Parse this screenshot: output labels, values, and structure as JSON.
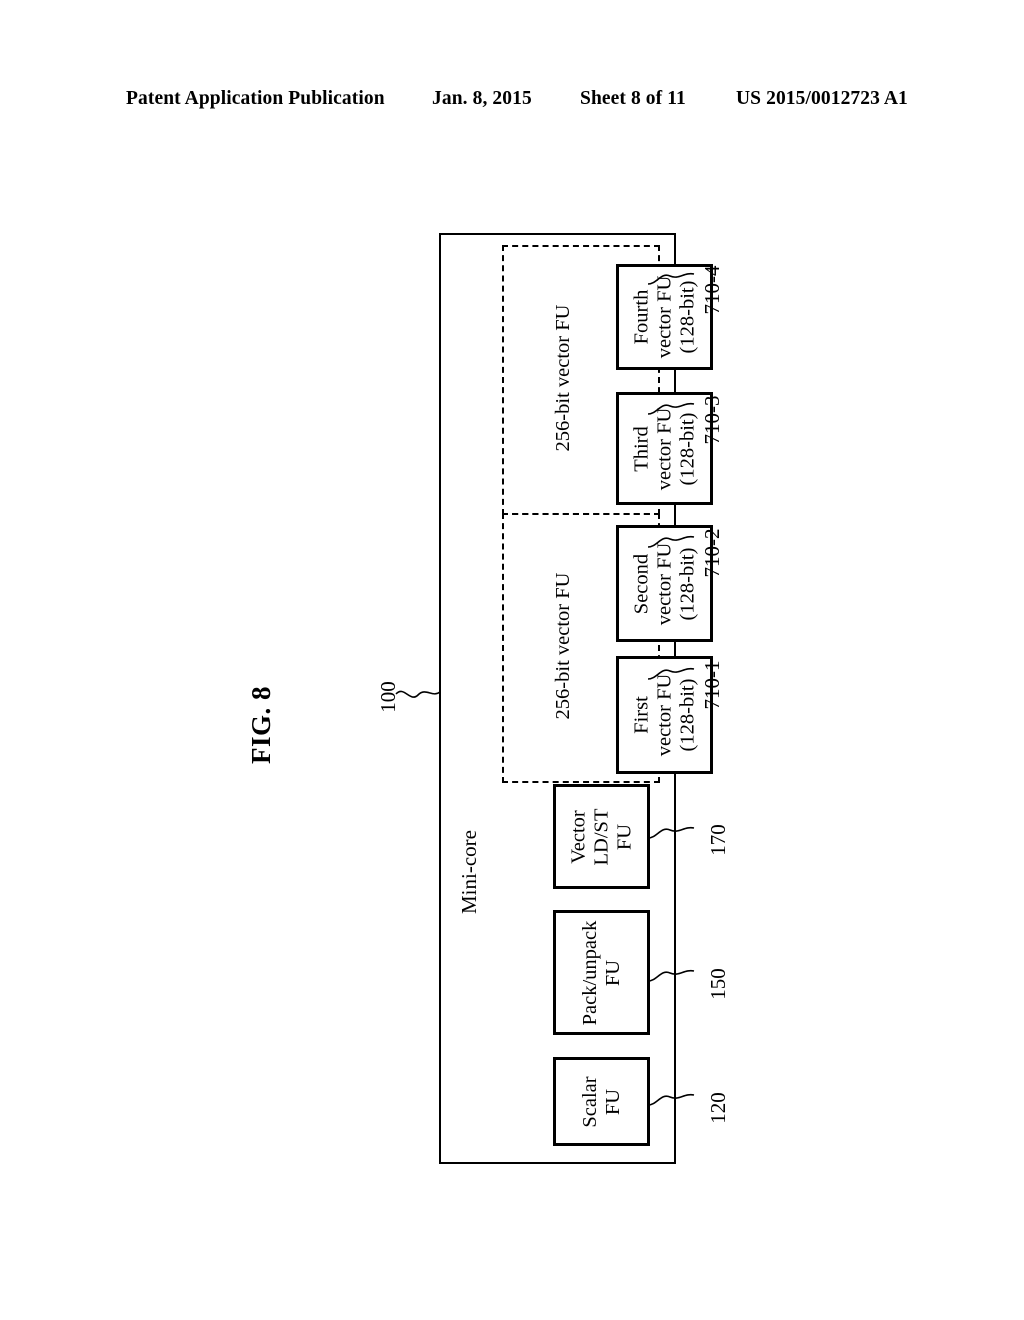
{
  "header": {
    "publication": "Patent Application Publication",
    "date": "Jan. 8, 2015",
    "sheet": "Sheet 8 of 11",
    "number": "US 2015/0012723 A1"
  },
  "figure": {
    "label": "FIG. 8",
    "main_ref": "100",
    "main_label": "Mini-core"
  },
  "groups": [
    {
      "label": "256-bit vector FU"
    },
    {
      "label": "256-bit vector FU"
    }
  ],
  "blocks": [
    {
      "id": "fourth-vector",
      "text": "Fourth\nvector FU\n(128-bit)",
      "ref": "710-4"
    },
    {
      "id": "third-vector",
      "text": "Third\nvector FU\n(128-bit)",
      "ref": "710-3"
    },
    {
      "id": "second-vector",
      "text": "Second\nvector FU\n(128-bit)",
      "ref": "710-2"
    },
    {
      "id": "first-vector",
      "text": "First\nvector FU\n(128-bit)",
      "ref": "710-1"
    },
    {
      "id": "vector-ldst",
      "text": "Vector\nLD/ST\nFU",
      "ref": "170"
    },
    {
      "id": "pack-unpack",
      "text": "Pack/unpack\nFU",
      "ref": "150"
    },
    {
      "id": "scalar",
      "text": "Scalar\nFU",
      "ref": "120"
    }
  ],
  "colors": {
    "ink": "#000000",
    "paper": "#ffffff"
  }
}
